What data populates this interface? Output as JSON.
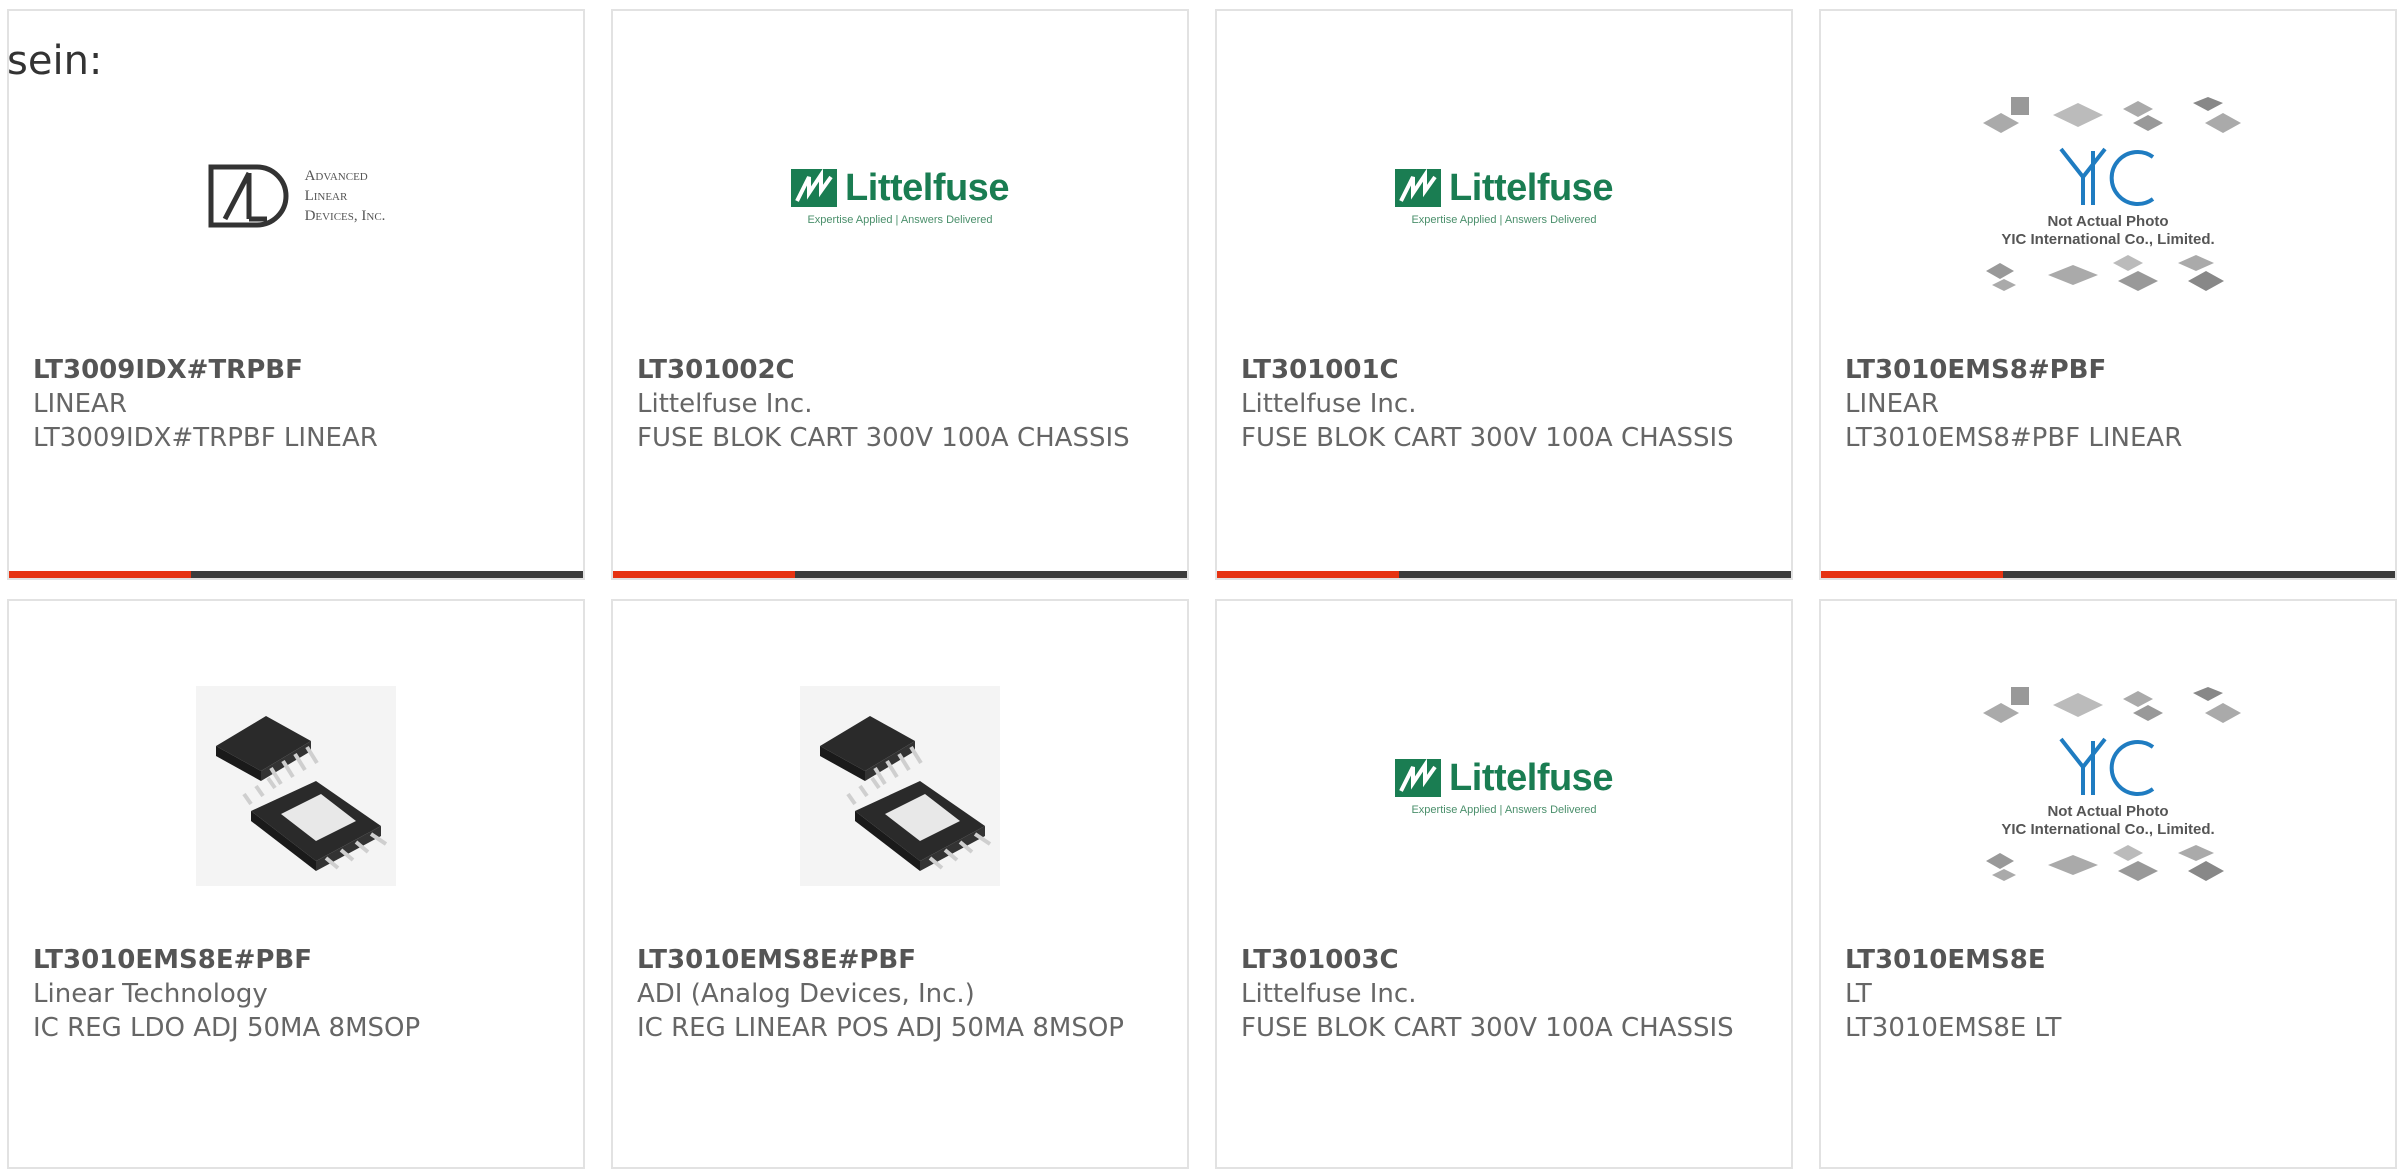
{
  "prefix_text": "sein:",
  "logos": {
    "adi": {
      "line1": "Advanced",
      "line2": "Linear",
      "line3": "Devices, Inc."
    },
    "littelfuse": {
      "word": "Littelfuse",
      "tagline": "Expertise Applied | Answers Delivered"
    },
    "yic": {
      "line1": "Not Actual Photo",
      "line2": "YIC International Co., Limited."
    }
  },
  "colors": {
    "accent": "#e63312",
    "bar": "#3c3c3c",
    "littelfuse_green": "#1a7d52",
    "yic_blue": "#1f7cc1"
  },
  "products": [
    {
      "part_number": "LT3009IDX#TRPBF",
      "manufacturer": "LINEAR",
      "description": "LT3009IDX#TRPBF LINEAR",
      "image": "adi-logo"
    },
    {
      "part_number": "LT301002C",
      "manufacturer": "Littelfuse Inc.",
      "description": "FUSE BLOK CART 300V 100A CHASSIS",
      "image": "littelfuse-logo"
    },
    {
      "part_number": "LT301001C",
      "manufacturer": "Littelfuse Inc.",
      "description": "FUSE BLOK CART 300V 100A CHASSIS",
      "image": "littelfuse-logo"
    },
    {
      "part_number": "LT3010EMS8#PBF",
      "manufacturer": "LINEAR",
      "description": "LT3010EMS8#PBF LINEAR",
      "image": "yic-placeholder"
    },
    {
      "part_number": "LT3010EMS8E#PBF",
      "manufacturer": "Linear Technology",
      "description": "IC REG LDO ADJ 50MA 8MSOP",
      "image": "msop-chip"
    },
    {
      "part_number": "LT3010EMS8E#PBF",
      "manufacturer": "ADI (Analog Devices, Inc.)",
      "description": "IC REG LINEAR POS ADJ 50MA 8MSOP",
      "image": "msop-chip"
    },
    {
      "part_number": "LT301003C",
      "manufacturer": "Littelfuse Inc.",
      "description": "FUSE BLOK CART 300V 100A CHASSIS",
      "image": "littelfuse-logo"
    },
    {
      "part_number": "LT3010EMS8E",
      "manufacturer": "LT",
      "description": "LT3010EMS8E LT",
      "image": "yic-placeholder"
    }
  ]
}
